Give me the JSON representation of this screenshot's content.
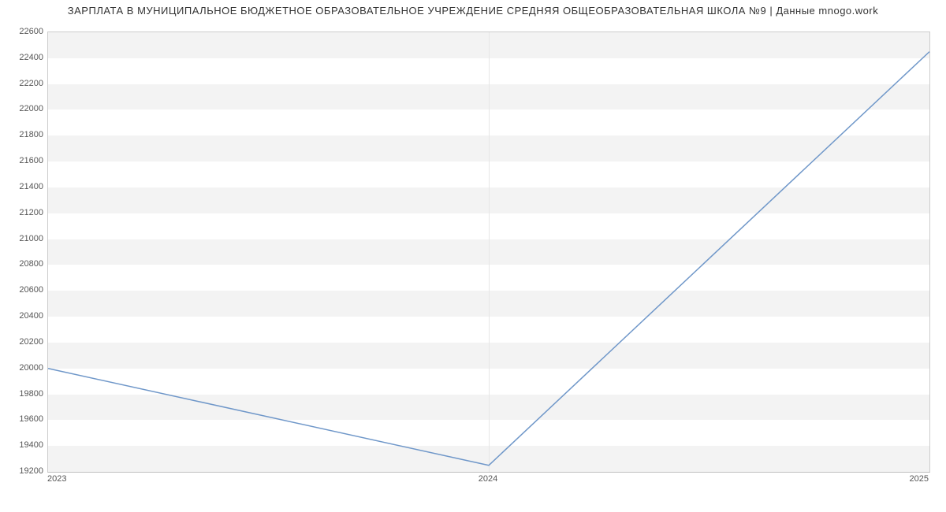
{
  "chart_data": {
    "type": "line",
    "title": "ЗАРПЛАТА В МУНИЦИПАЛЬНОЕ БЮДЖЕТНОЕ ОБРАЗОВАТЕЛЬНОЕ УЧРЕЖДЕНИЕ СРЕДНЯЯ ОБЩЕОБРАЗОВАТЕЛЬНАЯ ШКОЛА №9 | Данные mnogo.work",
    "x": [
      2023,
      2024,
      2025
    ],
    "y": [
      20000,
      19250,
      22450
    ],
    "x_ticks": [
      2023,
      2024,
      2025
    ],
    "y_ticks": [
      19200,
      19400,
      19600,
      19800,
      20000,
      20200,
      20400,
      20600,
      20800,
      21000,
      21200,
      21400,
      21600,
      21800,
      22000,
      22200,
      22400,
      22600
    ],
    "ylim": [
      19200,
      22600
    ],
    "xlim": [
      2023,
      2025
    ],
    "line_color": "#6f97c9",
    "band_color": "#f3f3f3"
  }
}
